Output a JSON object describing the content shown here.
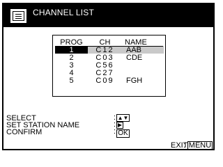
{
  "header": {
    "title": "CHANNEL LIST",
    "icon": "list-document-icon"
  },
  "channel_list": {
    "columns": [
      "PROG",
      "CH",
      "NAME"
    ],
    "rows": [
      {
        "prog": "1",
        "ch": "C12",
        "name": "AAB",
        "selected": true
      },
      {
        "prog": "2",
        "ch": "C03",
        "name": "CDE",
        "selected": false
      },
      {
        "prog": "3",
        "ch": "C56",
        "name": "",
        "selected": false
      },
      {
        "prog": "4",
        "ch": "C27",
        "name": "",
        "selected": false
      },
      {
        "prog": "5",
        "ch": "C09",
        "name": "FGH",
        "selected": false
      }
    ]
  },
  "operations": {
    "select_label": "SELECT",
    "set_station_name_label": "SET STATION NAME",
    "confirm_label": "CONFIRM",
    "select_key": "▲▼",
    "set_station_name_key": "▶",
    "confirm_key": "OK",
    "colon": ":"
  },
  "footer": {
    "exit_label": "EXIT",
    "menu_key": "MENU",
    "colon": ":"
  }
}
